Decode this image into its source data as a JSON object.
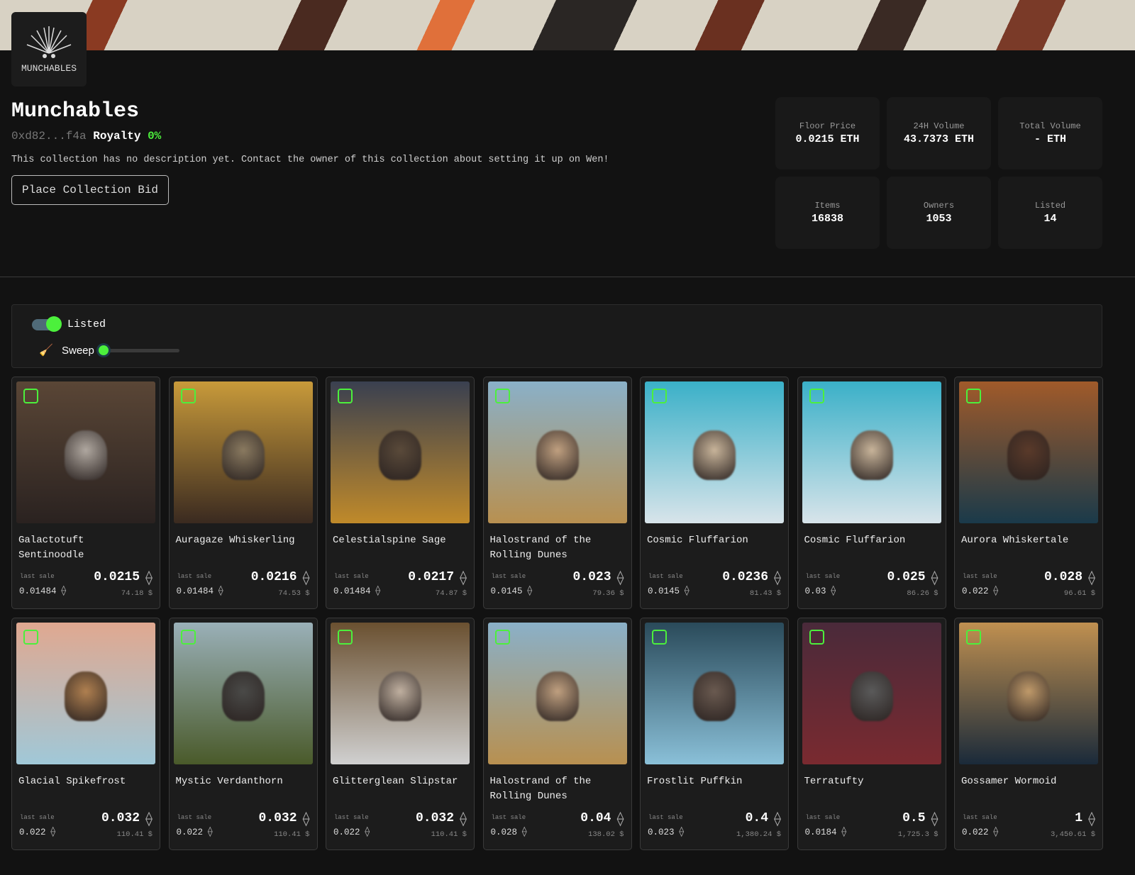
{
  "collection": {
    "name": "Munchables",
    "logo_text": "MUNCHABLES",
    "address": "0xd82...f4a",
    "royalty_label": "Royalty",
    "royalty_value": "0%",
    "description": "This collection has no description yet. Contact the owner of this collection about setting it up on Wen!",
    "bid_button": "Place Collection Bid"
  },
  "stats": [
    {
      "label": "Floor Price",
      "value": "0.0215 ETH"
    },
    {
      "label": "24H Volume",
      "value": "43.7373 ETH"
    },
    {
      "label": "Total Volume",
      "value": "- ETH"
    },
    {
      "label": "Items",
      "value": "16838"
    },
    {
      "label": "Owners",
      "value": "1053"
    },
    {
      "label": "Listed",
      "value": "14"
    }
  ],
  "filters": {
    "listed_label": "Listed",
    "listed_on": true,
    "sweep_label": "Sweep",
    "sweep_value": 0
  },
  "colors": {
    "accent": "#4cf03c",
    "background": "#121212",
    "card": "#1c1c1c"
  },
  "last_sale_label": "last sale",
  "items": [
    {
      "name": "Galactotuft Sentinoodle",
      "price": "0.0215",
      "usd": "74.18 $",
      "last_sale": "0.01484",
      "bg": [
        "#5a4636",
        "#2a2220"
      ],
      "fur": "#b0a8a0"
    },
    {
      "name": "Auragaze Whiskerling",
      "price": "0.0216",
      "usd": "74.53 $",
      "last_sale": "0.01484",
      "bg": [
        "#c89a3a",
        "#3a2a20"
      ],
      "fur": "#8a7a60"
    },
    {
      "name": "Celestialspine Sage",
      "price": "0.0217",
      "usd": "74.87 $",
      "last_sale": "0.01484",
      "bg": [
        "#3a4050",
        "#c08a2a"
      ],
      "fur": "#5a4a3a"
    },
    {
      "name": "Halostrand of the Rolling Dunes",
      "price": "0.023",
      "usd": "79.36 $",
      "last_sale": "0.0145",
      "bg": [
        "#8ab0c8",
        "#b89050"
      ],
      "fur": "#c0a080"
    },
    {
      "name": "Cosmic Fluffarion",
      "price": "0.0236",
      "usd": "81.43 $",
      "last_sale": "0.0145",
      "bg": [
        "#3ab0c8",
        "#d8e4ea"
      ],
      "fur": "#c8b49a"
    },
    {
      "name": "Cosmic Fluffarion",
      "price": "0.025",
      "usd": "86.26 $",
      "last_sale": "0.03",
      "bg": [
        "#3ab0c8",
        "#d8e4ea"
      ],
      "fur": "#c8b49a"
    },
    {
      "name": "Aurora Whiskertale",
      "price": "0.028",
      "usd": "96.61 $",
      "last_sale": "0.022",
      "bg": [
        "#a05a2a",
        "#1a3a4a"
      ],
      "fur": "#5a3a2a"
    },
    {
      "name": "Glacial Spikefrost",
      "price": "0.032",
      "usd": "110.41 $",
      "last_sale": "0.022",
      "bg": [
        "#e0a890",
        "#a0c8d8"
      ],
      "fur": "#b08050"
    },
    {
      "name": "Mystic Verdanthorn",
      "price": "0.032",
      "usd": "110.41 $",
      "last_sale": "0.022",
      "bg": [
        "#9ab0b8",
        "#4a5a2a"
      ],
      "fur": "#4a4a48"
    },
    {
      "name": "Glitterglean Slipstar",
      "price": "0.032",
      "usd": "110.41 $",
      "last_sale": "0.022",
      "bg": [
        "#6a5030",
        "#d0d0d0"
      ],
      "fur": "#c0b0a0"
    },
    {
      "name": "Halostrand of the Rolling Dunes",
      "price": "0.04",
      "usd": "138.02 $",
      "last_sale": "0.028",
      "bg": [
        "#8ab0c8",
        "#b89050"
      ],
      "fur": "#c0a080"
    },
    {
      "name": "Frostlit Puffkin",
      "price": "0.4",
      "usd": "1,380.24 $",
      "last_sale": "0.023",
      "bg": [
        "#2a4a5a",
        "#8ac0d8"
      ],
      "fur": "#6a5a50"
    },
    {
      "name": "Terratufty",
      "price": "0.5",
      "usd": "1,725.3 $",
      "last_sale": "0.0184",
      "bg": [
        "#4a2a3a",
        "#7a2a30"
      ],
      "fur": "#5a5a5a"
    },
    {
      "name": "Gossamer Wormoid",
      "price": "1",
      "usd": "3,450.61 $",
      "last_sale": "0.022",
      "bg": [
        "#c09050",
        "#1a2a3a"
      ],
      "fur": "#c09a6a"
    }
  ]
}
